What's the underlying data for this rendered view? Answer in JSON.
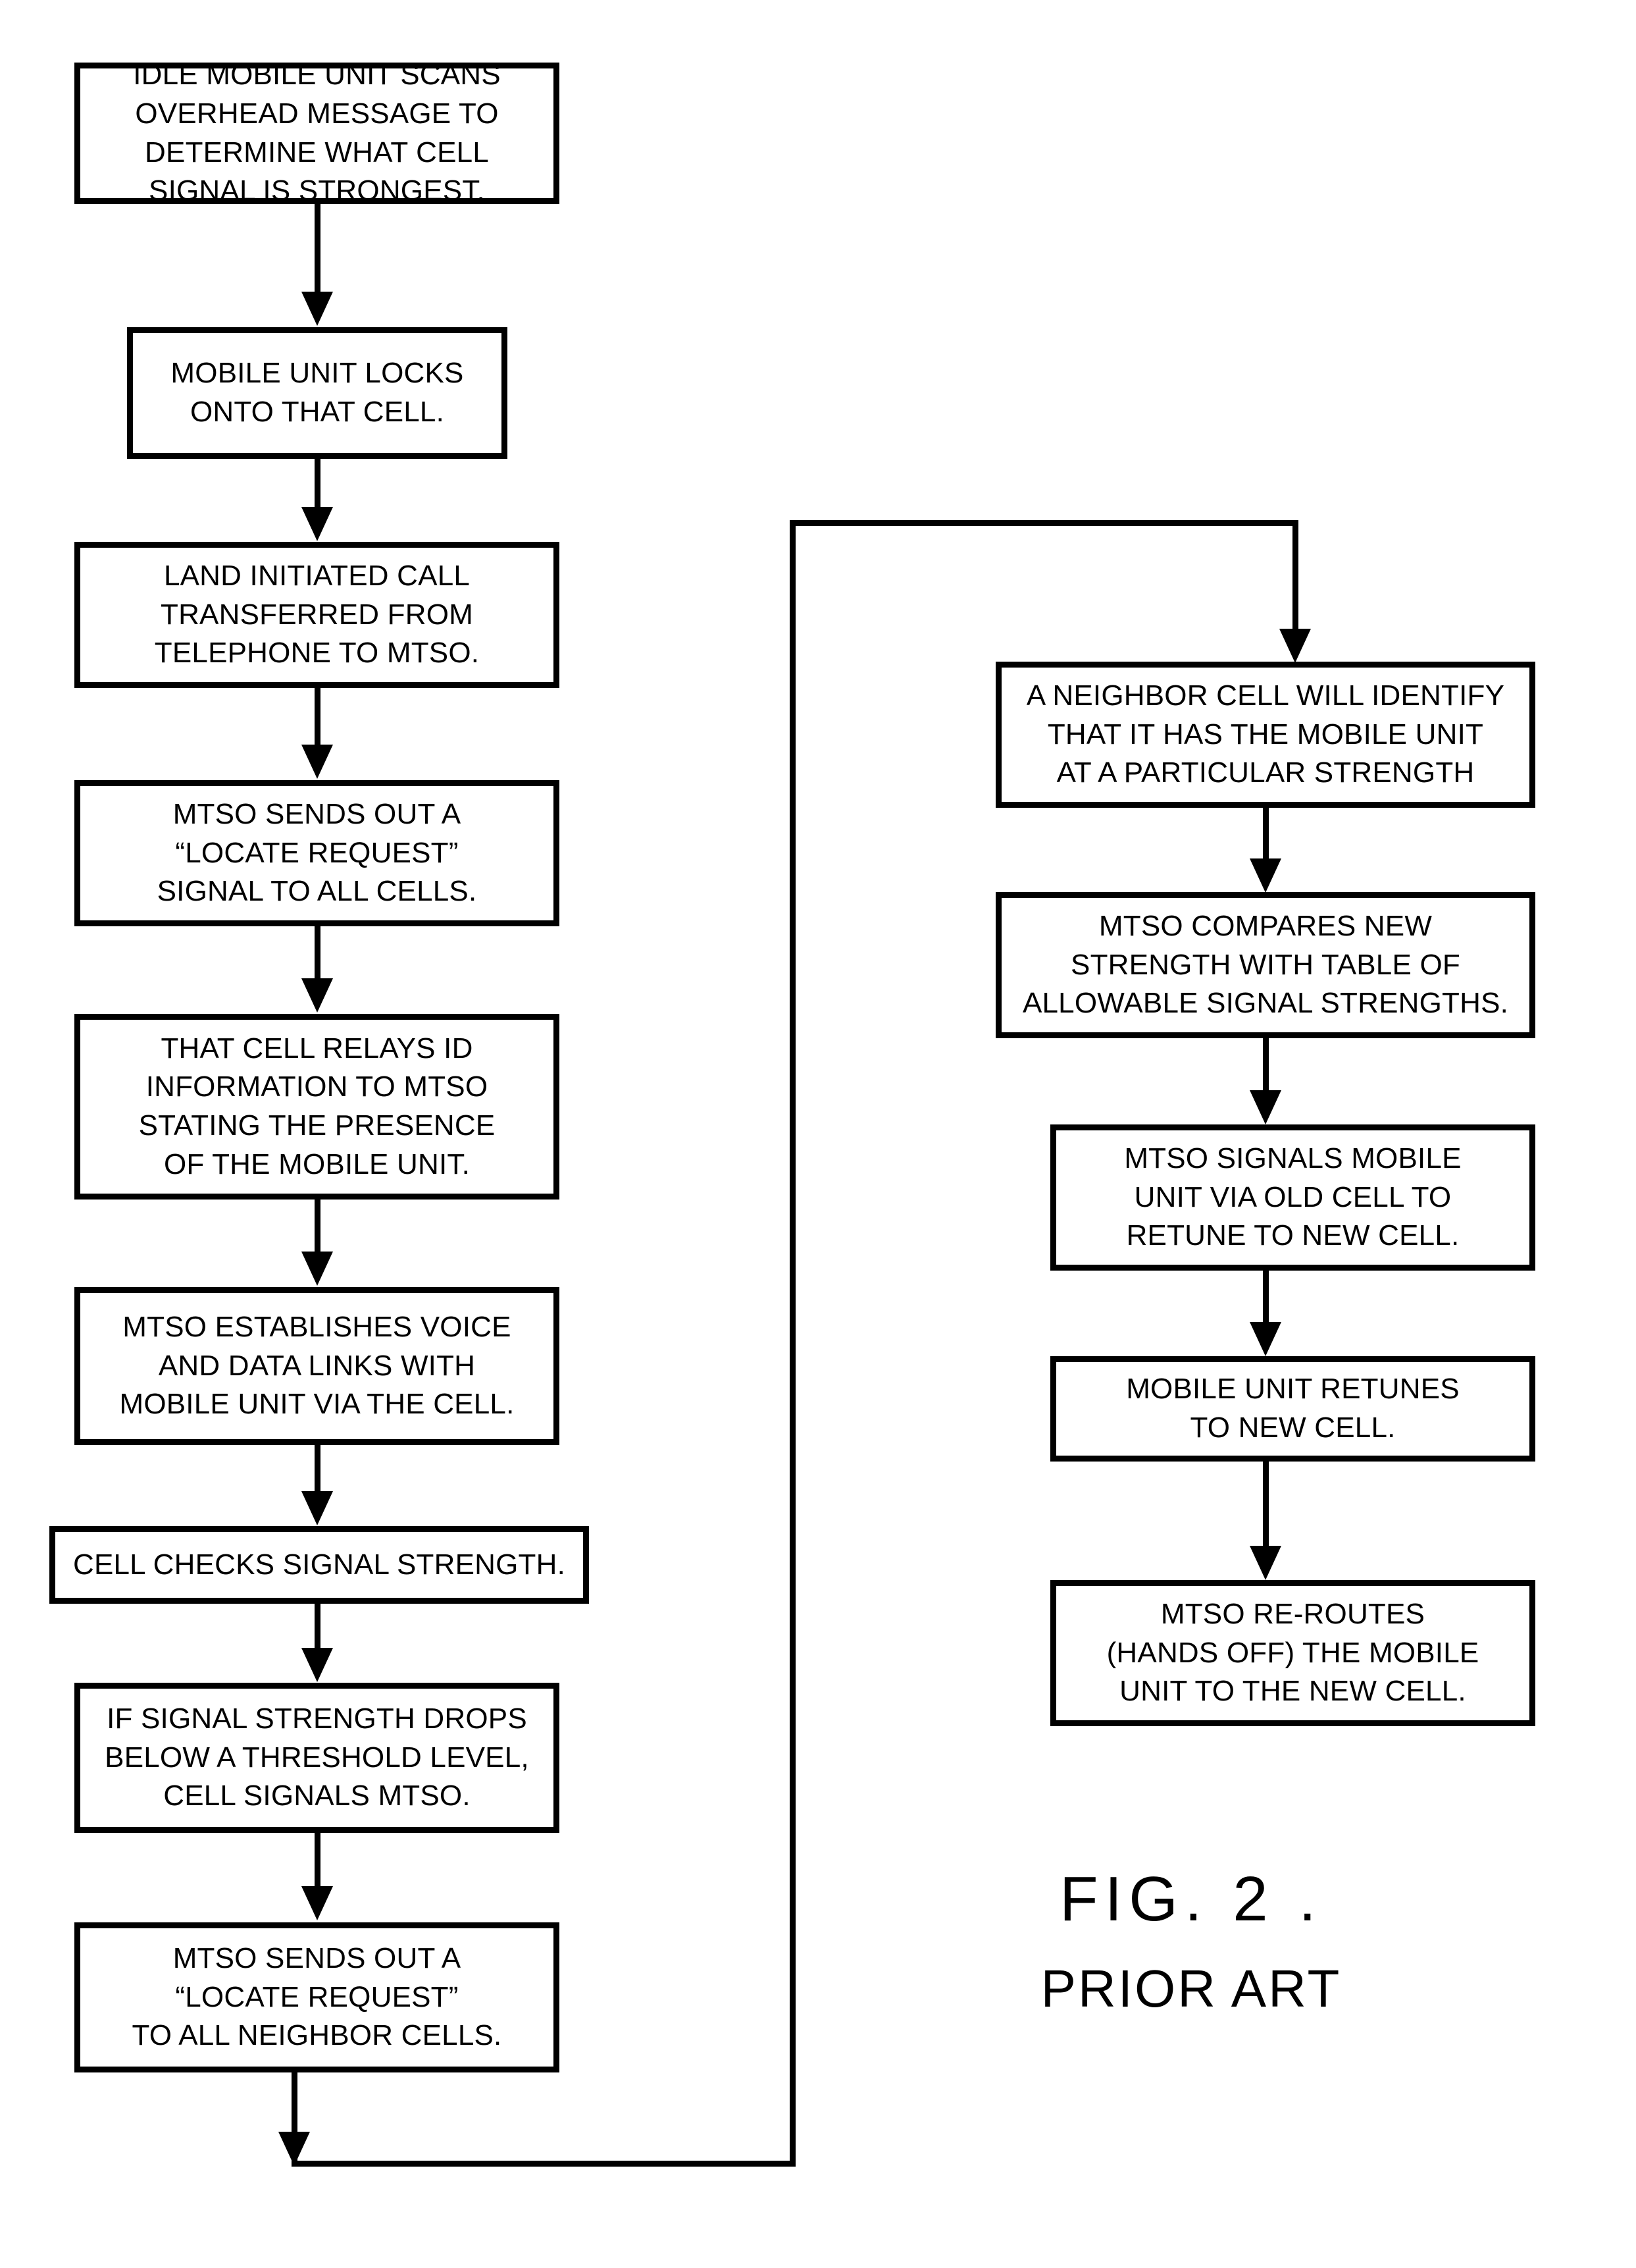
{
  "figure": {
    "number_label": "FIG. 2 .",
    "subtitle": "PRIOR ART"
  },
  "flowchart": {
    "type": "flowchart",
    "orientation": "two-column, top-to-bottom, with feedback loop",
    "left_column": [
      {
        "id": "L1",
        "text": "IDLE MOBILE UNIT SCANS\nOVERHEAD MESSAGE TO\nDETERMINE WHAT CELL\nSIGNAL IS STRONGEST."
      },
      {
        "id": "L2",
        "text": "MOBILE UNIT LOCKS\nONTO THAT CELL."
      },
      {
        "id": "L3",
        "text": "LAND INITIATED CALL\nTRANSFERRED FROM\nTELEPHONE TO MTSO."
      },
      {
        "id": "L4",
        "text": "MTSO SENDS OUT A\n“LOCATE  REQUEST”\nSIGNAL TO ALL CELLS."
      },
      {
        "id": "L5",
        "text": "THAT CELL RELAYS ID\nINFORMATION TO MTSO\nSTATING THE PRESENCE\nOF THE MOBILE UNIT."
      },
      {
        "id": "L6",
        "text": "MTSO ESTABLISHES VOICE\nAND DATA LINKS WITH\nMOBILE UNIT VIA THE CELL."
      },
      {
        "id": "L7",
        "text": "CELL CHECKS SIGNAL STRENGTH."
      },
      {
        "id": "L8",
        "text": "IF SIGNAL STRENGTH DROPS\nBELOW A THRESHOLD LEVEL,\nCELL SIGNALS MTSO."
      },
      {
        "id": "L9",
        "text": "MTSO SENDS OUT A\n“LOCATE REQUEST”\nTO ALL NEIGHBOR CELLS."
      }
    ],
    "right_column": [
      {
        "id": "R1",
        "text": "A NEIGHBOR CELL WILL IDENTIFY\nTHAT IT HAS THE MOBILE UNIT\nAT A PARTICULAR STRENGTH"
      },
      {
        "id": "R2",
        "text": "MTSO COMPARES NEW\nSTRENGTH WITH TABLE OF\nALLOWABLE SIGNAL STRENGTHS."
      },
      {
        "id": "R3",
        "text": "MTSO SIGNALS MOBILE\nUNIT VIA OLD CELL TO\nRETUNE TO NEW CELL."
      },
      {
        "id": "R4",
        "text": "MOBILE UNIT RETUNES\nTO NEW CELL."
      },
      {
        "id": "R5",
        "text": "MTSO RE-ROUTES\n(HANDS OFF) THE MOBILE\nUNIT TO THE NEW CELL."
      }
    ],
    "edges": [
      "L1->L2",
      "L2->L3",
      "L3->L4",
      "L4->L5",
      "L5->L6",
      "L6->L7",
      "L7->L8",
      "L8->L9",
      "L9->loop",
      "loop->R1",
      "R1->R2",
      "R2->R3",
      "R3->R4",
      "R4->R5"
    ]
  },
  "colors": {
    "stroke": "#000000",
    "background": "#ffffff"
  }
}
